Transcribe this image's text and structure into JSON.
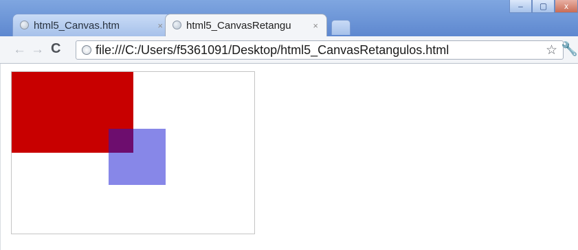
{
  "browser": {
    "tabs": [
      {
        "title": "html5_Canvas.htm",
        "active": false,
        "close_glyph": "×",
        "icon": "globe-icon"
      },
      {
        "title": "html5_CanvasRetangu",
        "active": true,
        "close_glyph": "×",
        "icon": "globe-icon"
      }
    ],
    "window_controls": {
      "minimize": "–",
      "maximize": "▢",
      "close": "x"
    },
    "toolbar": {
      "back_glyph": "←",
      "forward_glyph": "→",
      "reload_glyph": "C",
      "url": "file:///C:/Users/f5361091/Desktop/html5_CanvasRetangulos.html",
      "bookmark_glyph": "☆",
      "wrench_glyph": "🔧"
    }
  },
  "canvas": {
    "rectangles": [
      {
        "name": "red-rectangle",
        "color": "#c80000"
      },
      {
        "name": "blue-translucent-rectangle",
        "color": "rgba(25,25,210,0.52)"
      }
    ]
  },
  "colors": {
    "titlebar": "#6f98da",
    "tab_active": "#f3f5f8",
    "rect_red": "#c80000",
    "rect_blue": "#5a5ae0"
  }
}
